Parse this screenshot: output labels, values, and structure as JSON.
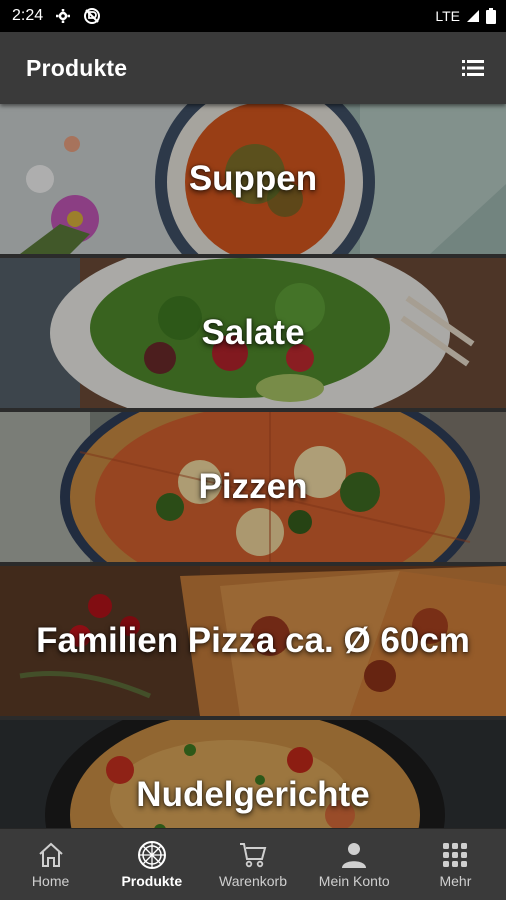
{
  "status_bar": {
    "time": "2:24",
    "network": "LTE",
    "icons": [
      "gear-icon",
      "no-disturb-icon",
      "signal-icon",
      "battery-icon"
    ]
  },
  "app_bar": {
    "title": "Produkte",
    "action_icon": "list-view-icon"
  },
  "categories": [
    {
      "label": "Suppen"
    },
    {
      "label": "Salate"
    },
    {
      "label": "Pizzen"
    },
    {
      "label": "Familien Pizza ca. Ø 60cm"
    },
    {
      "label": "Nudelgerichte"
    }
  ],
  "bottom_nav": {
    "items": [
      {
        "label": "Home",
        "icon": "home-icon",
        "active": false
      },
      {
        "label": "Produkte",
        "icon": "pizza-icon",
        "active": true
      },
      {
        "label": "Warenkorb",
        "icon": "cart-icon",
        "active": false
      },
      {
        "label": "Mein Konto",
        "icon": "person-icon",
        "active": false
      },
      {
        "label": "Mehr",
        "icon": "grid-icon",
        "active": false
      }
    ]
  },
  "colors": {
    "app_bar": "#3a3a3a",
    "status_bar": "#000000",
    "text": "#ffffff",
    "nav_inactive": "#cfcfcf"
  }
}
